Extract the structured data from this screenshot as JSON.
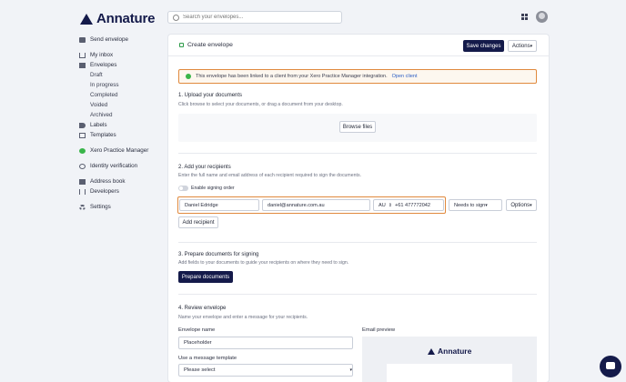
{
  "app": {
    "brand": "Annature"
  },
  "search": {
    "placeholder": "Search your envelopes..."
  },
  "sidebar": {
    "send_envelope": "Send envelope",
    "my_inbox": "My inbox",
    "envelopes": "Envelopes",
    "envelope_subitems": [
      "Draft",
      "In progress",
      "Completed",
      "Voided",
      "Archived"
    ],
    "labels": "Labels",
    "templates": "Templates",
    "xero": "Xero Practice Manager",
    "identity": "Identity verification",
    "address_book": "Address book",
    "developers": "Developers",
    "settings": "Settings"
  },
  "card": {
    "title": "Create envelope",
    "save": "Save changes",
    "actions": "Actions"
  },
  "alert": {
    "text": "This envelope has been linked to a client from your Xero Practice Manager integration.",
    "link": "Open client"
  },
  "upload": {
    "heading": "1. Upload your documents",
    "sub": "Click browse to select your documents, or drag a document from your desktop.",
    "browse": "Browse files"
  },
  "recipients": {
    "heading": "2. Add your recipients",
    "sub": "Enter the full name and email address of each recipient required to sign the documents.",
    "signing_order": "Enable signing order",
    "name": "Daniel Edridge",
    "email": "daniel@annature.com.au",
    "country": "AU",
    "phone": "+61 477772042",
    "role": "Needs to sign",
    "options": "Options",
    "add": "Add recipient"
  },
  "prepare": {
    "heading": "3. Prepare documents for signing",
    "sub": "Add fields to your documents to guide your recipients on where they need to sign.",
    "button": "Prepare documents"
  },
  "review": {
    "heading": "4. Review envelope",
    "sub": "Name your envelope and enter a message for your recipients.",
    "name_label": "Envelope name",
    "name_value": "Placeholder",
    "template_label": "Use a message template",
    "template_value": "Please select",
    "preview_label": "Email preview",
    "preview_brand": "Annature"
  }
}
